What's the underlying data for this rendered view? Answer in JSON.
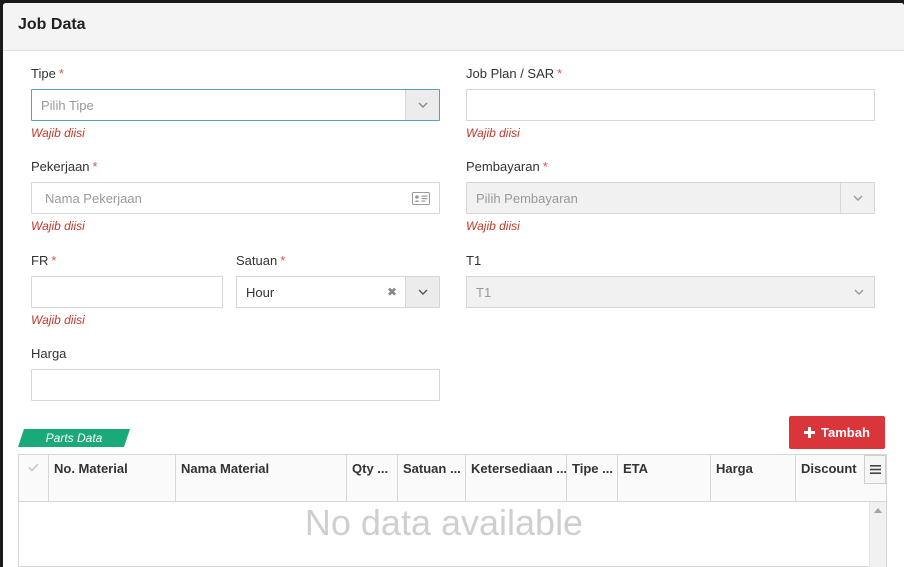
{
  "modal": {
    "title": "Job Data"
  },
  "form": {
    "required_mark": "*",
    "tipe": {
      "label": "Tipe",
      "placeholder": "Pilih Tipe",
      "error": "Wajib diisi"
    },
    "job_plan": {
      "label": "Job Plan / SAR",
      "value": "",
      "error": "Wajib diisi"
    },
    "pekerjaan": {
      "label": "Pekerjaan",
      "placeholder": "Nama Pekerjaan",
      "error": "Wajib diisi"
    },
    "pembayaran": {
      "label": "Pembayaran",
      "placeholder": "Pilih Pembayaran",
      "error": "Wajib diisi"
    },
    "fr": {
      "label": "FR",
      "value": "",
      "error": "Wajib diisi"
    },
    "satuan": {
      "label": "Satuan",
      "value": "Hour",
      "clear_glyph": "✖"
    },
    "t1": {
      "label": "T1",
      "value": "T1"
    },
    "harga": {
      "label": "Harga",
      "value": ""
    }
  },
  "parts": {
    "tag": "Parts Data",
    "add_button": "Tambah",
    "columns": [
      "No. Material",
      "Nama Material",
      "Qty ...",
      "Satuan ...",
      "Ketersediaan ...",
      "Tipe ...",
      "ETA",
      "Harga",
      "Discount"
    ],
    "empty_text": "No data available"
  },
  "colors": {
    "accent_red": "#d9353b",
    "tag_green": "#1aaa7a",
    "error_text": "#c0392b"
  }
}
